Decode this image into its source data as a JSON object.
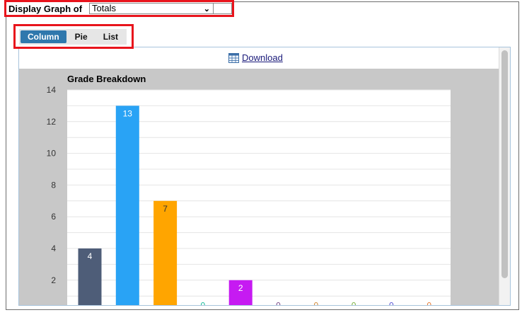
{
  "header": {
    "label": "Display Graph of",
    "selected": "Totals"
  },
  "tabs": [
    {
      "label": "Column",
      "active": true
    },
    {
      "label": "Pie",
      "active": false
    },
    {
      "label": "List",
      "active": false
    }
  ],
  "toolbar": {
    "download_label": "Download"
  },
  "chart_data": {
    "type": "bar",
    "title": "Grade Breakdown",
    "xlabel": "",
    "ylabel": "",
    "ylim": [
      0,
      14
    ],
    "yticks": [
      2,
      4,
      6,
      8,
      10,
      12,
      14
    ],
    "grid": true,
    "values": [
      4,
      13,
      7,
      0,
      2,
      0,
      0,
      0,
      0,
      0
    ],
    "colors": [
      "#4e5d78",
      "#29a3f5",
      "#ffa500",
      "#1abc9c",
      "#c61af2",
      "#7a4d8a",
      "#d08a3a",
      "#7cb342",
      "#5a55d6",
      "#e57e3a"
    ]
  },
  "colors": {
    "highlight": "#e8141c",
    "active_tab": "#2f78ad",
    "plot_bg": "#c8c8c8"
  }
}
